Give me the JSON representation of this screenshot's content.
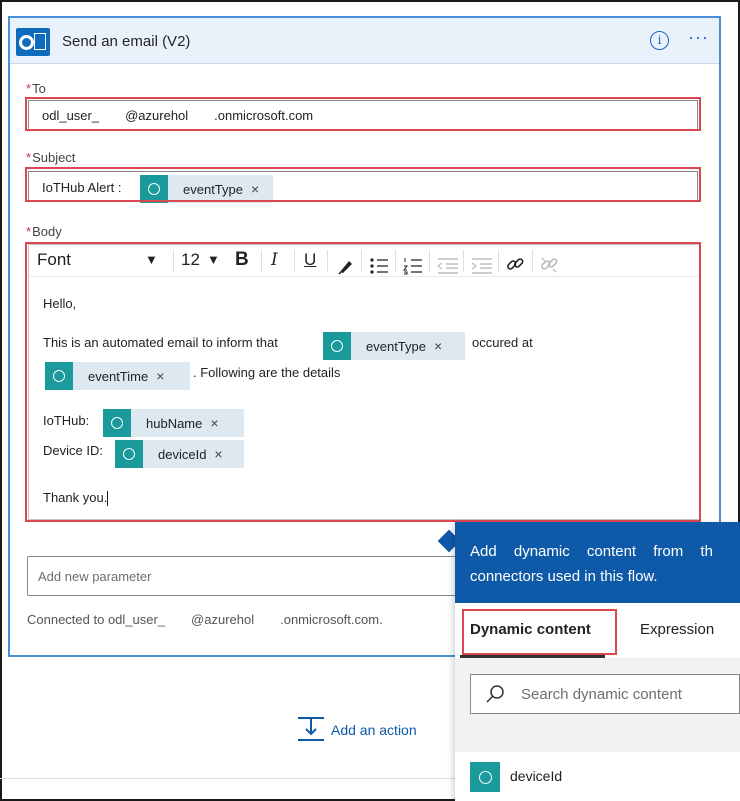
{
  "card": {
    "title": "Send an email (V2)",
    "info_glyph": "i",
    "more_glyph": "···"
  },
  "fields": {
    "to_label": "To",
    "to_value": "odl_user_  @azurehol  .onmicrosoft.com",
    "subject_label": "Subject",
    "subject_prefix": "IoTHub Alert :",
    "subject_token": "eventType",
    "body_label": "Body",
    "required_mark": "*"
  },
  "toolbar": {
    "font": "Font",
    "size": "12",
    "bold": "B",
    "italic": "I",
    "underline": "U"
  },
  "body": {
    "hello": "Hello,",
    "line1_prefix": "This is an automated email to inform that",
    "line1_token": "eventType",
    "line1_suffix": "occured at",
    "line2_token": "eventTime",
    "line2_suffix": ". Following are the details",
    "iothub_label": "IoTHub:",
    "iothub_token": "hubName",
    "device_label": "Device ID:",
    "device_token": "deviceId",
    "thanks": "Thank you."
  },
  "token_close": "×",
  "add_parameter_placeholder": "Add new parameter",
  "connected_text": "Connected to odl_user_  @azurehol  .onmicrosoft.com.",
  "add_action_label": "Add an action",
  "dynamic_panel": {
    "header_line1": "Add dynamic content from th",
    "header_line2": "connectors used in this flow.",
    "tab_dynamic": "Dynamic content",
    "tab_expression": "Expression",
    "search_placeholder": "Search dynamic content",
    "item": "deviceId"
  },
  "colors": {
    "accent": "#0f5aa8",
    "token_icon": "#1a9a9a",
    "highlight_red": "#d9474f",
    "card_border": "#4a8fd6"
  }
}
